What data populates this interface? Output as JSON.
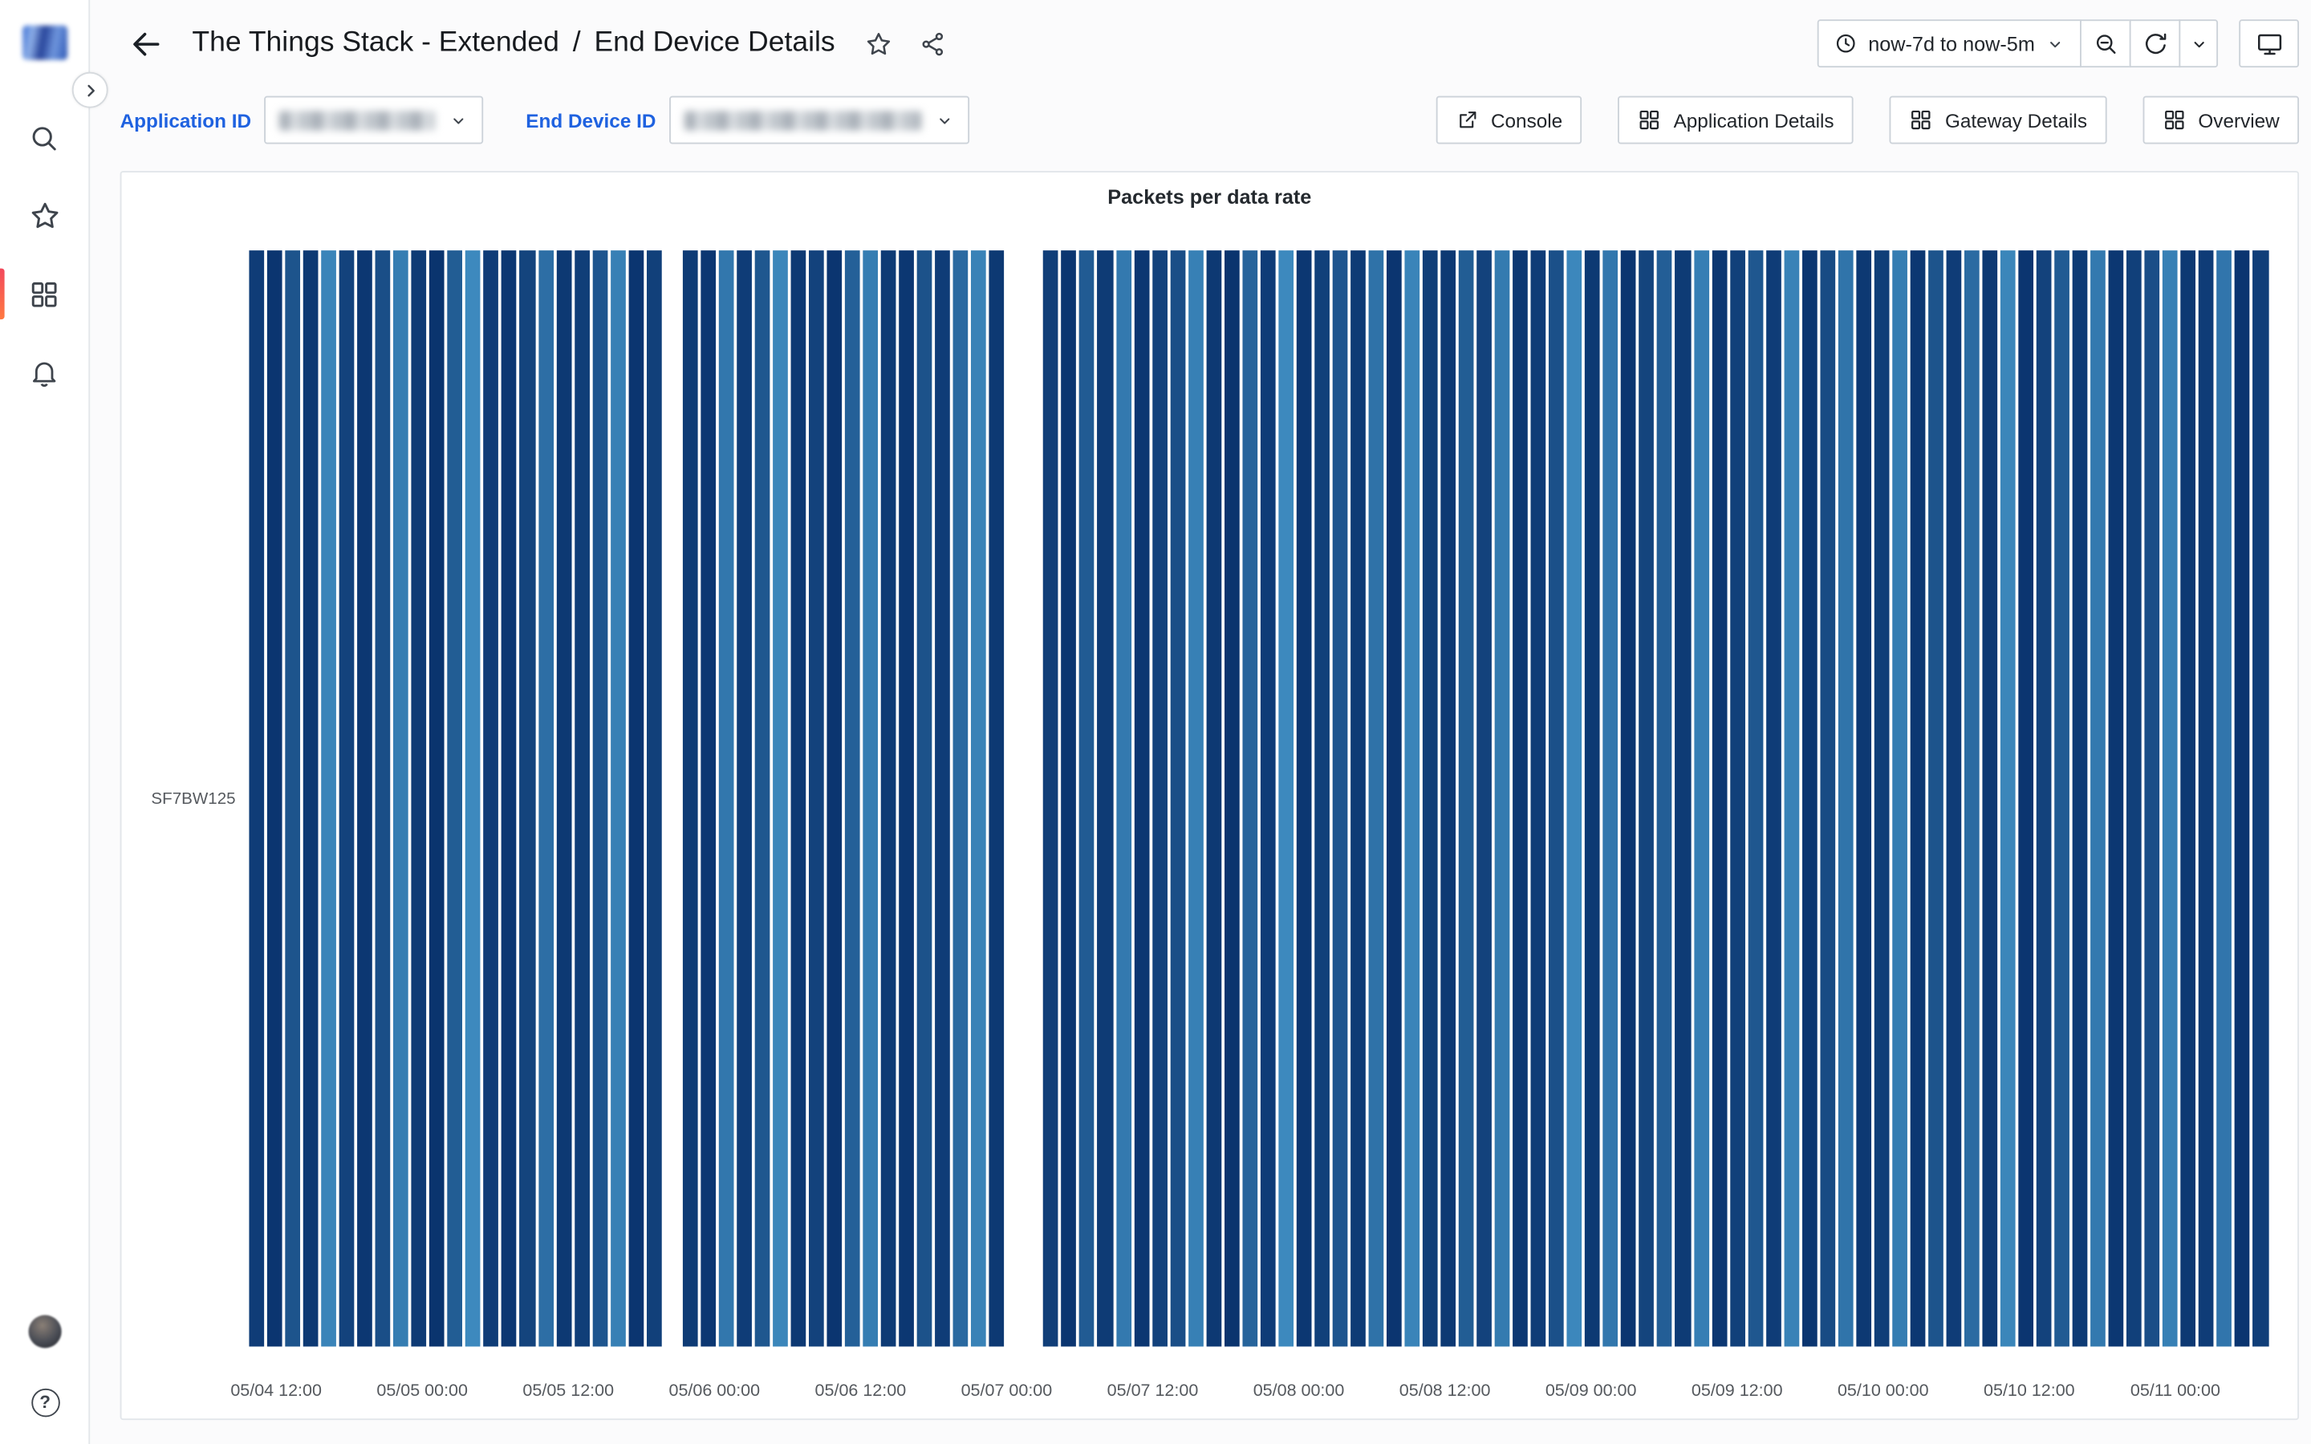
{
  "colors": {
    "accent_blue": "#1f62e0",
    "active_nav_indicator": "#f2495c",
    "heatmap_low": "#4292c6",
    "heatmap_high": "#08306b"
  },
  "sidebar": {
    "items": [
      "search",
      "starred",
      "dashboards",
      "alerting"
    ],
    "active_item": "dashboards",
    "help_glyph": "?"
  },
  "breadcrumb": {
    "dashboard": "The Things Stack - Extended",
    "separator": "/",
    "page": "End Device Details"
  },
  "toolbar": {
    "time_range": "now-7d to now-5m"
  },
  "variables": {
    "application_id": {
      "label": "Application ID",
      "value_hidden": true
    },
    "end_device_id": {
      "label": "End Device ID",
      "value_hidden": true
    }
  },
  "dashboard_links": {
    "console": "Console",
    "application_details": "Application Details",
    "gateway_details": "Gateway Details",
    "overview": "Overview"
  },
  "panel": {
    "title": "Packets per data rate"
  },
  "chart_data": {
    "type": "heatmap",
    "title": "Packets per data rate",
    "y_categories": [
      "SF7BW125"
    ],
    "x_range": "now-7d to now-5m",
    "x_tick_labels": [
      "05/04 12:00",
      "05/05 00:00",
      "05/05 12:00",
      "05/06 00:00",
      "05/06 12:00",
      "05/07 00:00",
      "05/07 12:00",
      "05/08 00:00",
      "05/08 12:00",
      "05/09 00:00",
      "05/09 12:00",
      "05/10 00:00",
      "05/10 12:00",
      "05/11 00:00"
    ],
    "value_unit": "packets",
    "series": [
      {
        "name": "SF7BW125",
        "values": [
          88,
          92,
          75,
          90,
          48,
          85,
          91,
          78,
          52,
          89,
          93,
          70,
          45,
          88,
          91,
          84,
          60,
          90,
          87,
          74,
          50,
          92,
          86,
          null,
          89,
          91,
          55,
          88,
          73,
          47,
          90,
          85,
          92,
          68,
          52,
          89,
          91,
          76,
          88,
          63,
          49,
          90,
          null,
          null,
          87,
          92,
          71,
          89,
          54,
          91,
          85,
          78,
          50,
          90,
          93,
          66,
          88,
          45,
          91,
          86,
          74,
          89,
          58,
          92,
          48,
          87,
          90,
          70,
          85,
          53,
          91,
          88,
          77,
          46,
          90,
          55,
          92,
          84,
          69,
          89,
          51,
          91,
          86,
          73,
          88,
          49,
          92,
          80,
          57,
          90,
          87,
          52,
          91,
          75,
          88,
          62,
          90,
          47,
          92,
          85,
          71,
          89,
          54,
          91,
          86,
          78,
          50,
          90,
          88,
          56,
          92,
          87
        ]
      }
    ],
    "color_scale": {
      "scheme": "blues",
      "low": "#4292c6",
      "high": "#08306b",
      "min": 40,
      "max": 95
    },
    "legend": false,
    "grid": false,
    "layout": {
      "x_tick_first_pct": 1.34,
      "x_tick_step_pct": 7.238
    }
  }
}
